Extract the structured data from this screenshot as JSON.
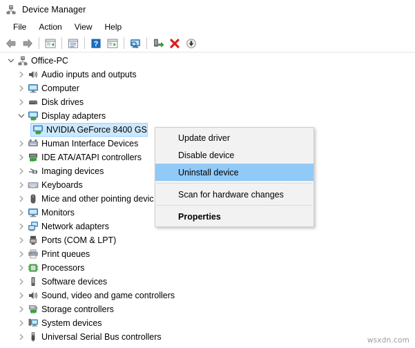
{
  "window": {
    "title": "Device Manager",
    "icon": "device-manager-icon"
  },
  "menubar": {
    "items": [
      {
        "label": "File"
      },
      {
        "label": "Action"
      },
      {
        "label": "View"
      },
      {
        "label": "Help"
      }
    ]
  },
  "toolbar": {
    "buttons": [
      {
        "name": "back-button",
        "icon": "back-arrow-icon"
      },
      {
        "name": "forward-button",
        "icon": "forward-arrow-icon"
      },
      {
        "name": "separator-1",
        "icon": "separator"
      },
      {
        "name": "show-hide-console-tree-button",
        "icon": "console-tree-icon"
      },
      {
        "name": "separator-2",
        "icon": "separator"
      },
      {
        "name": "properties-button",
        "icon": "properties-window-icon"
      },
      {
        "name": "separator-3",
        "icon": "separator"
      },
      {
        "name": "help-button",
        "icon": "help-question-icon"
      },
      {
        "name": "show-hide-action-pane-button",
        "icon": "action-pane-icon"
      },
      {
        "name": "separator-4",
        "icon": "separator"
      },
      {
        "name": "scan-for-hardware-changes-button",
        "icon": "scan-monitor-icon"
      },
      {
        "name": "separator-5",
        "icon": "separator"
      },
      {
        "name": "update-driver-button",
        "icon": "update-driver-icon"
      },
      {
        "name": "uninstall-device-button",
        "icon": "red-x-icon"
      },
      {
        "name": "disable-device-button",
        "icon": "down-arrow-circle-icon"
      }
    ]
  },
  "tree": {
    "root": {
      "label": "Office-PC",
      "icon": "computer-root-icon",
      "expanded": true
    },
    "nodes": [
      {
        "label": "Audio inputs and outputs",
        "icon": "speaker-icon",
        "expanded": false,
        "level": 1
      },
      {
        "label": "Computer",
        "icon": "monitor-icon",
        "expanded": false,
        "level": 1
      },
      {
        "label": "Disk drives",
        "icon": "disk-drive-icon",
        "expanded": false,
        "level": 1
      },
      {
        "label": "Display adapters",
        "icon": "display-adapter-icon",
        "expanded": true,
        "level": 1
      },
      {
        "label": "NVIDIA GeForce 8400 GS",
        "icon": "display-adapter-icon",
        "level": 2,
        "selected": true
      },
      {
        "label": "Human Interface Devices",
        "icon": "hid-icon",
        "expanded": false,
        "level": 1
      },
      {
        "label": "IDE ATA/ATAPI controllers",
        "icon": "ide-controller-icon",
        "expanded": false,
        "level": 1
      },
      {
        "label": "Imaging devices",
        "icon": "camera-icon",
        "expanded": false,
        "level": 1
      },
      {
        "label": "Keyboards",
        "icon": "keyboard-icon",
        "expanded": false,
        "level": 1
      },
      {
        "label": "Mice and other pointing devic",
        "icon": "mouse-icon",
        "expanded": false,
        "level": 1
      },
      {
        "label": "Monitors",
        "icon": "monitor-icon",
        "expanded": false,
        "level": 1
      },
      {
        "label": "Network adapters",
        "icon": "network-adapter-icon",
        "expanded": false,
        "level": 1
      },
      {
        "label": "Ports (COM & LPT)",
        "icon": "port-icon",
        "expanded": false,
        "level": 1
      },
      {
        "label": "Print queues",
        "icon": "printer-icon",
        "expanded": false,
        "level": 1
      },
      {
        "label": "Processors",
        "icon": "processor-icon",
        "expanded": false,
        "level": 1
      },
      {
        "label": "Software devices",
        "icon": "software-device-icon",
        "expanded": false,
        "level": 1
      },
      {
        "label": "Sound, video and game controllers",
        "icon": "speaker-icon",
        "expanded": false,
        "level": 1
      },
      {
        "label": "Storage controllers",
        "icon": "storage-controller-icon",
        "expanded": false,
        "level": 1
      },
      {
        "label": "System devices",
        "icon": "system-device-icon",
        "expanded": false,
        "level": 1
      },
      {
        "label": "Universal Serial Bus controllers",
        "icon": "usb-icon",
        "expanded": false,
        "level": 1
      }
    ]
  },
  "context_menu": {
    "items": [
      {
        "label": "Update driver",
        "highlighted": false,
        "bold": false
      },
      {
        "label": "Disable device",
        "highlighted": false,
        "bold": false
      },
      {
        "label": "Uninstall device",
        "highlighted": true,
        "bold": false
      },
      {
        "separator": true
      },
      {
        "label": "Scan for hardware changes",
        "highlighted": false,
        "bold": false
      },
      {
        "separator": true
      },
      {
        "label": "Properties",
        "highlighted": false,
        "bold": true
      }
    ]
  },
  "watermark": {
    "text": "wsxdn.com"
  },
  "colors": {
    "selection_blue": "#cce8ff",
    "menu_highlight_blue": "#91c9f7",
    "menu_background": "#f2f2f2",
    "window_background": "#ffffff"
  }
}
